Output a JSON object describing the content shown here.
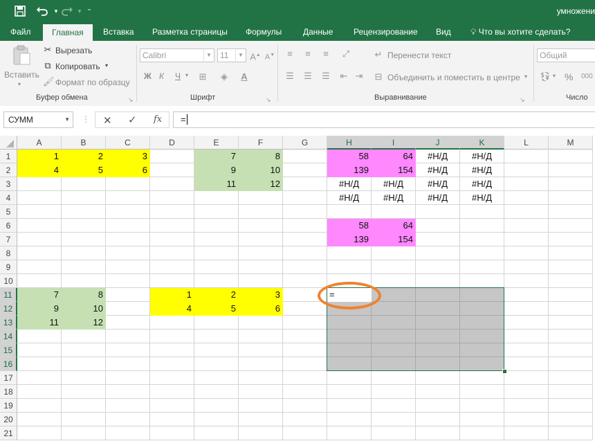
{
  "doc_title": "умножени",
  "tabs": [
    "Файл",
    "Главная",
    "Вставка",
    "Разметка страницы",
    "Формулы",
    "Данные",
    "Рецензирование",
    "Вид"
  ],
  "tell_me": "Что вы хотите сделать?",
  "ribbon": {
    "paste": "Вставить",
    "cut": "Вырезать",
    "copy": "Копировать",
    "format_painter": "Формат по образцу",
    "clipboard_group": "Буфер обмена",
    "font_name": "Calibri",
    "font_size": "11",
    "bold": "Ж",
    "italic": "К",
    "underline": "Ч",
    "font_group": "Шрифт",
    "wrap_text": "Перенести текст",
    "merge_center": "Объединить и поместить в центре",
    "alignment_group": "Выравнивание",
    "number_format": "Общий",
    "percent": "%",
    "number_group": "Число"
  },
  "name_box": "СУММ",
  "formula": "=",
  "columns": [
    "A",
    "B",
    "C",
    "D",
    "E",
    "F",
    "G",
    "H",
    "I",
    "J",
    "K",
    "L",
    "M"
  ],
  "rows": [
    "1",
    "2",
    "3",
    "4",
    "5",
    "6",
    "7",
    "8",
    "9",
    "10",
    "11",
    "12",
    "13",
    "14",
    "15",
    "16",
    "17",
    "18",
    "19",
    "20",
    "21"
  ],
  "cells": {
    "A1": "1",
    "B1": "2",
    "C1": "3",
    "A2": "4",
    "B2": "5",
    "C2": "6",
    "E1": "7",
    "F1": "8",
    "E2": "9",
    "F2": "10",
    "E3": "11",
    "F3": "12",
    "H1": "58",
    "I1": "64",
    "J1": "#Н/Д",
    "K1": "#Н/Д",
    "H2": "139",
    "I2": "154",
    "J2": "#Н/Д",
    "K2": "#Н/Д",
    "H3": "#Н/Д",
    "I3": "#Н/Д",
    "J3": "#Н/Д",
    "K3": "#Н/Д",
    "H4": "#Н/Д",
    "I4": "#Н/Д",
    "J4": "#Н/Д",
    "K4": "#Н/Д",
    "H6": "58",
    "I6": "64",
    "H7": "139",
    "I7": "154",
    "A11": "7",
    "B11": "8",
    "A12": "9",
    "B12": "10",
    "A13": "11",
    "B13": "12",
    "D11": "1",
    "E11": "2",
    "F11": "3",
    "D12": "4",
    "E12": "5",
    "F12": "6",
    "H11": "="
  },
  "fills": {
    "A1": "yellow",
    "B1": "yellow",
    "C1": "yellow",
    "A2": "yellow",
    "B2": "yellow",
    "C2": "yellow",
    "E1": "green",
    "F1": "green",
    "E2": "green",
    "F2": "green",
    "E3": "green",
    "F3": "green",
    "H1": "pink",
    "I1": "pink",
    "H2": "pink",
    "I2": "pink",
    "H6": "pink",
    "I6": "pink",
    "H7": "pink",
    "I7": "pink",
    "A11": "green",
    "B11": "green",
    "A12": "green",
    "B12": "green",
    "A13": "green",
    "B13": "green",
    "D11": "yellow",
    "E11": "yellow",
    "F11": "yellow",
    "D12": "yellow",
    "E12": "yellow",
    "F12": "yellow"
  },
  "selection": "H11:K16",
  "colors": {
    "excel_green": "#217346",
    "selection_border": "#217346",
    "highlight_circle": "#f0822d"
  }
}
